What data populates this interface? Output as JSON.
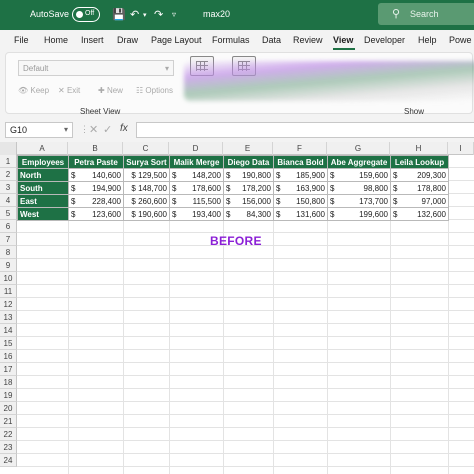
{
  "titlebar": {
    "autosave_label": "AutoSave",
    "autosave_state": "Off",
    "file_name": "max20",
    "search_placeholder": "Search",
    "bg_color": "#1e7145"
  },
  "menu": {
    "tabs": [
      "File",
      "Home",
      "Insert",
      "Draw",
      "Page Layout",
      "Formulas",
      "Data",
      "Review",
      "View",
      "Developer",
      "Help",
      "Powe"
    ],
    "active": "View"
  },
  "ribbon": {
    "sheet_view_dropdown": "Default",
    "keep_label": "Keep",
    "exit_label": "Exit",
    "new_label": "New",
    "options_label": "Options",
    "group_sheet_view": "Sheet View",
    "group_show": "Show"
  },
  "formula_bar": {
    "name_box": "G10",
    "fx_label": "fx",
    "content": ""
  },
  "grid": {
    "columns": [
      "A",
      "B",
      "C",
      "D",
      "E",
      "F",
      "G",
      "H",
      "I"
    ],
    "rows": [
      "1",
      "2",
      "3",
      "4",
      "5",
      "6",
      "7",
      "8",
      "9",
      "10",
      "11",
      "12",
      "13",
      "14",
      "15",
      "16",
      "17",
      "18",
      "19",
      "20",
      "21",
      "22",
      "23",
      "24"
    ],
    "header_color": "#1e7145"
  },
  "table": {
    "headers": [
      "Employees",
      "Petra Paste",
      "Surya Sort",
      "Malik Merge",
      "Diego Data",
      "Bianca Bold",
      "Abe Aggregate",
      "Leila Lookup"
    ],
    "currency": "$",
    "rows": [
      {
        "region": "North",
        "values": [
          "140,600",
          "$ 129,500",
          "148,200",
          "190,800",
          "185,900",
          "159,600",
          "209,300"
        ]
      },
      {
        "region": "South",
        "values": [
          "194,900",
          "$ 148,700",
          "178,600",
          "178,200",
          "163,900",
          "98,800",
          "178,800"
        ]
      },
      {
        "region": "East",
        "values": [
          "228,400",
          "$ 260,600",
          "115,500",
          "156,000",
          "150,800",
          "173,700",
          "97,000"
        ]
      },
      {
        "region": "West",
        "values": [
          "123,600",
          "$ 190,600",
          "193,400",
          "84,300",
          "131,600",
          "199,600",
          "132,600"
        ]
      }
    ]
  },
  "overlay_text": "BEFORE",
  "overlay_color": "#8b1fd6"
}
